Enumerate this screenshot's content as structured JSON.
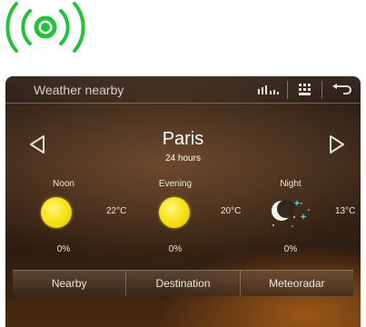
{
  "app": {
    "title": "Weather nearby"
  },
  "location": {
    "city": "Paris",
    "period": "24 hours"
  },
  "forecast": [
    {
      "label": "Noon",
      "temp": "22°C",
      "precip": "0%",
      "icon": "sun-icon"
    },
    {
      "label": "Evening",
      "temp": "20°C",
      "precip": "0%",
      "icon": "sun-icon"
    },
    {
      "label": "Night",
      "temp": "13°C",
      "precip": "0%",
      "icon": "moon-stars-icon"
    }
  ],
  "tabs": [
    {
      "label": "Nearby"
    },
    {
      "label": "Destination"
    },
    {
      "label": "Meteoradar"
    }
  ],
  "icons": {
    "indicator": "broadcast-icon",
    "toolbar": [
      "signal-bars-icon",
      "keypad-icon",
      "back-arrow-icon"
    ],
    "nav": [
      "previous-location-icon",
      "next-location-icon"
    ]
  },
  "colors": {
    "indicator_green": "#22c33a",
    "sun_yellow": "#f6de10",
    "background_brown": "#2d1c10"
  }
}
